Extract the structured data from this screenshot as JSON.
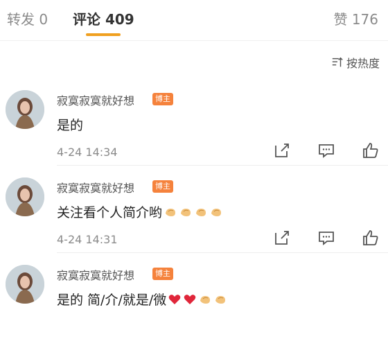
{
  "tabs": {
    "repost": "转发 0",
    "comment": "评论 409",
    "like": "赞 176"
  },
  "sort": {
    "label": "按热度",
    "icon": "sort-icon"
  },
  "comments": [
    {
      "username": "寂寞寂寞就好想",
      "badge": "博主",
      "content": "是的",
      "time": "4-24 14:34"
    },
    {
      "username": "寂寞寂寞就好想",
      "badge": "博主",
      "content": "关注看个人简介哟",
      "time": "4-24 14:31"
    },
    {
      "username": "寂寞寂寞就好想",
      "badge": "博主",
      "content": "是的 简/介/就是/微",
      "time": ""
    }
  ],
  "colors": {
    "accent": "#f0a020",
    "badge": "#f5823c"
  }
}
